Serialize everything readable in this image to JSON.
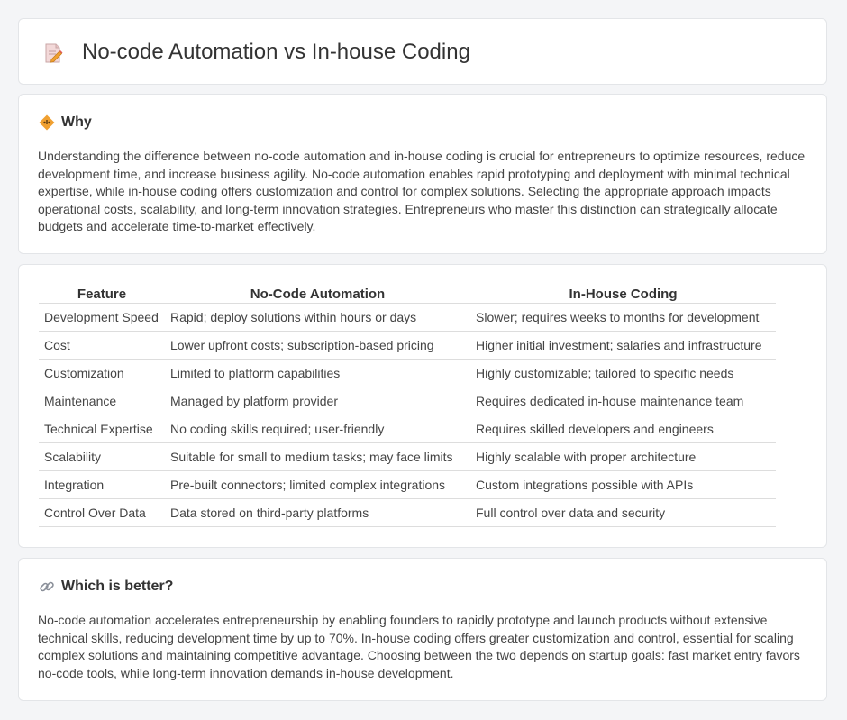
{
  "page": {
    "title": "No-code Automation vs In-house Coding"
  },
  "why": {
    "heading": "Why",
    "text": "Understanding the difference between no-code automation and in-house coding is crucial for entrepreneurs to optimize resources, reduce development time, and increase business agility. No-code automation enables rapid prototyping and deployment with minimal technical expertise, while in-house coding offers customization and control for complex solutions. Selecting the appropriate approach impacts operational costs, scalability, and long-term innovation strategies. Entrepreneurs who master this distinction can strategically allocate budgets and accelerate time-to-market effectively."
  },
  "table": {
    "headers": [
      "Feature",
      "No-Code Automation",
      "In-House Coding"
    ],
    "rows": [
      [
        "Development Speed",
        "Rapid; deploy solutions within hours or days",
        "Slower; requires weeks to months for development"
      ],
      [
        "Cost",
        "Lower upfront costs; subscription-based pricing",
        "Higher initial investment; salaries and infrastructure"
      ],
      [
        "Customization",
        "Limited to platform capabilities",
        "Highly customizable; tailored to specific needs"
      ],
      [
        "Maintenance",
        "Managed by platform provider",
        "Requires dedicated in-house maintenance team"
      ],
      [
        "Technical Expertise",
        "No coding skills required; user-friendly",
        "Requires skilled developers and engineers"
      ],
      [
        "Scalability",
        "Suitable for small to medium tasks; may face limits",
        "Highly scalable with proper architecture"
      ],
      [
        "Integration",
        "Pre-built connectors; limited complex integrations",
        "Custom integrations possible with APIs"
      ],
      [
        "Control Over Data",
        "Data stored on third-party platforms",
        "Full control over data and security"
      ]
    ]
  },
  "better": {
    "heading": "Which is better?",
    "text": "No-code automation accelerates entrepreneurship by enabling founders to rapidly prototype and launch products without extensive technical skills, reducing development time by up to 70%. In-house coding offers greater customization and control, essential for scaling complex solutions and maintaining competitive advantage. Choosing between the two depends on startup goals: fast market entry favors no-code tools, while long-term innovation demands in-house development."
  },
  "icons": {
    "title": "document-pencil-icon",
    "why": "diamond-warning-icon",
    "better": "link-icon"
  },
  "colors": {
    "accent_orange": "#f0a030",
    "link_gray": "#8a8f99"
  }
}
